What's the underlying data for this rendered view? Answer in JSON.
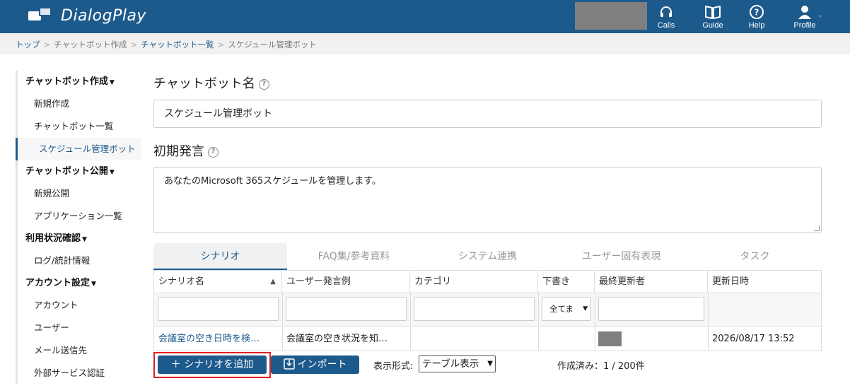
{
  "header": {
    "app_name": "DialogPlay",
    "nav": [
      {
        "label": "Calls",
        "icon": "headset-icon"
      },
      {
        "label": "Guide",
        "icon": "book-icon"
      },
      {
        "label": "Help",
        "icon": "help-circle-icon"
      },
      {
        "label": "Profile",
        "icon": "user-icon"
      }
    ]
  },
  "breadcrumb": [
    "トップ",
    "チャットボット作成",
    "チャットボット一覧",
    "スケジュール管理ボット"
  ],
  "sidebar": {
    "sections": [
      {
        "title": "チャットボット作成",
        "items": [
          "新規作成",
          "チャットボット一覧",
          "スケジュール管理ボット"
        ]
      },
      {
        "title": "チャットボット公開",
        "items": [
          "新規公開",
          "アプリケーション一覧"
        ]
      },
      {
        "title": "利用状況確認",
        "items": [
          "ログ/統計情報"
        ]
      },
      {
        "title": "アカウント設定",
        "items": [
          "アカウント",
          "ユーザー",
          "メール送信先",
          "外部サービス認証"
        ]
      }
    ],
    "active_item": "スケジュール管理ボット"
  },
  "form": {
    "name_label": "チャットボット名",
    "name_value": "スケジュール管理ボット",
    "greeting_label": "初期発言",
    "greeting_value": "あなたのMicrosoft 365スケジュールを管理します。"
  },
  "tabs": [
    "シナリオ",
    "FAQ集/参考資料",
    "システム連携",
    "ユーザー固有表現",
    "タスク"
  ],
  "active_tab": "シナリオ",
  "table": {
    "columns": [
      "シナリオ名",
      "ユーザー発言例",
      "カテゴリ",
      "下書き",
      "最終更新者",
      "更新日時"
    ],
    "draft_filter": "全てま",
    "rows": [
      {
        "name": "会議室の空き日時を検…",
        "example": "会議室の空き状況を知…",
        "category": "",
        "draft": "",
        "updated_at": "2026/08/17 13:52"
      }
    ]
  },
  "footer": {
    "add_button": "シナリオを追加",
    "import_button": "インポート",
    "display_label": "表示形式:",
    "display_value": "テーブル表示",
    "count_text": "作成済み：1 / 200件"
  },
  "colors": {
    "brand": "#1d5a8c",
    "highlight": "#e02020"
  }
}
